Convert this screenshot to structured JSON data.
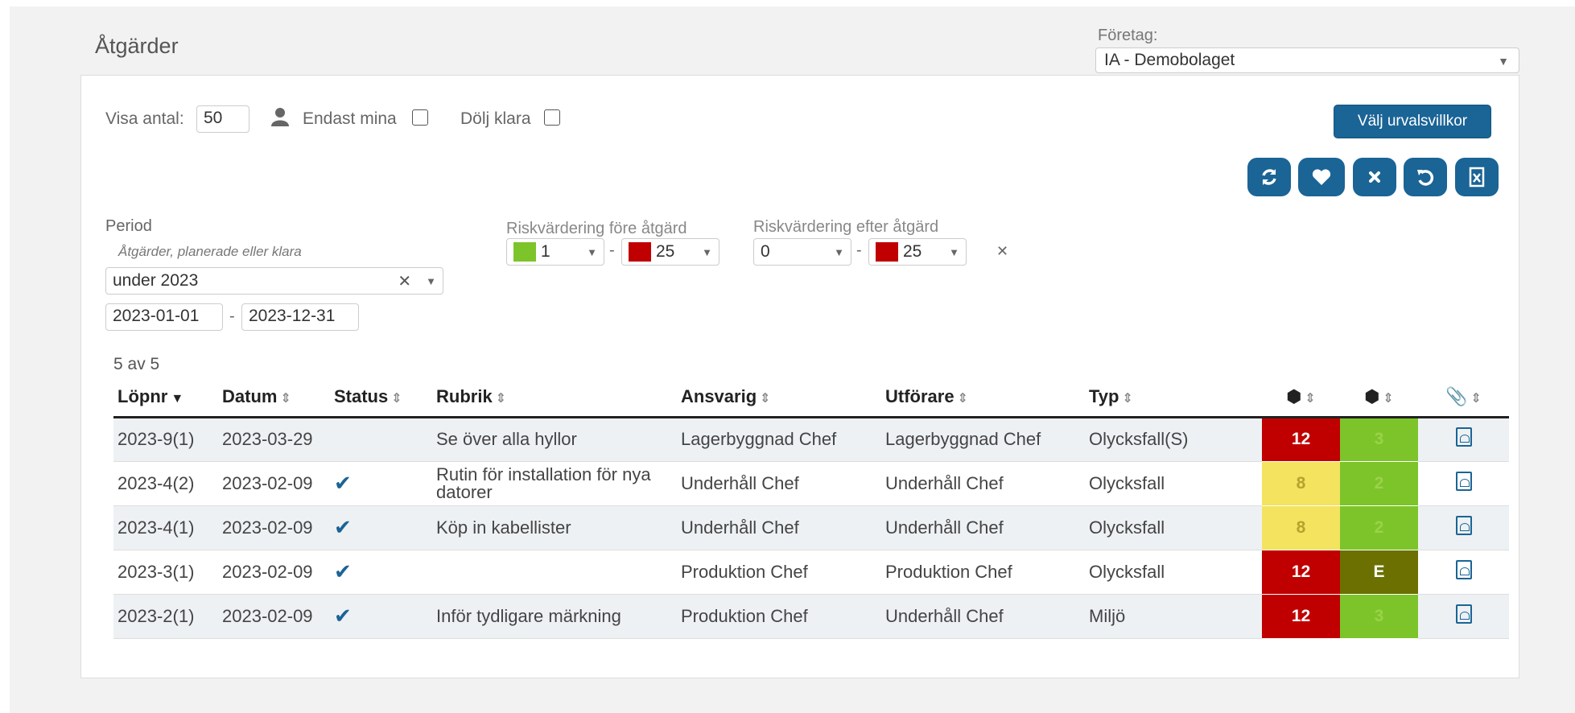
{
  "page": {
    "title": "Åtgärder"
  },
  "company": {
    "label": "Företag:",
    "value": "IA - Demobolaget"
  },
  "filters": {
    "show_count_label": "Visa antal:",
    "show_count_value": "50",
    "only_mine_label": "Endast mina",
    "hide_done_label": "Dölj klara",
    "choose_criteria_label": "Välj urvalsvillkor",
    "period_label": "Period",
    "period_hint": "Åtgärder, planerade eller klara",
    "period_value": "under 2023",
    "date_from": "2023-01-01",
    "date_to": "2023-12-31",
    "risk_before_label": "Riskvärdering före åtgärd",
    "risk_before_from": "1",
    "risk_before_to": "25",
    "risk_after_label": "Riskvärdering efter åtgärd",
    "risk_after_from": "0",
    "risk_after_to": "25",
    "dash": "-"
  },
  "colors": {
    "primary": "#1a6496",
    "risk_red": "#c00000",
    "risk_yellow": "#f3e35f",
    "risk_green": "#7cc42a",
    "risk_olive": "#6b7000"
  },
  "table": {
    "count_text": "5 av 5",
    "columns": [
      "Löpnr",
      "Datum",
      "Status",
      "Rubrik",
      "Ansvarig",
      "Utförare",
      "Typ"
    ],
    "rows": [
      {
        "lopnr": "2023-9(1)",
        "datum": "2023-03-29",
        "done": false,
        "rubrik": "Se över alla hyllor",
        "ansvarig": "Lagerbyggnad Chef",
        "utforare": "Lagerbyggnad Chef",
        "typ": "Olycksfall(S)",
        "risk_before": "12",
        "risk_before_color": "#c00000",
        "risk_after": "3",
        "risk_after_color": "#7cc42a"
      },
      {
        "lopnr": "2023-4(2)",
        "datum": "2023-02-09",
        "done": true,
        "rubrik": "Rutin för installation för nya datorer",
        "ansvarig": "Underhåll Chef",
        "utforare": "Underhåll Chef",
        "typ": "Olycksfall",
        "risk_before": "8",
        "risk_before_color": "#f3e35f",
        "risk_after": "2",
        "risk_after_color": "#7cc42a"
      },
      {
        "lopnr": "2023-4(1)",
        "datum": "2023-02-09",
        "done": true,
        "rubrik": "Köp in kabellister",
        "ansvarig": "Underhåll Chef",
        "utforare": "Underhåll Chef",
        "typ": "Olycksfall",
        "risk_before": "8",
        "risk_before_color": "#f3e35f",
        "risk_after": "2",
        "risk_after_color": "#7cc42a"
      },
      {
        "lopnr": "2023-3(1)",
        "datum": "2023-02-09",
        "done": true,
        "rubrik": "",
        "ansvarig": "Produktion Chef",
        "utforare": "Produktion Chef",
        "typ": "Olycksfall",
        "risk_before": "12",
        "risk_before_color": "#c00000",
        "risk_after": "E",
        "risk_after_color": "#6b7000"
      },
      {
        "lopnr": "2023-2(1)",
        "datum": "2023-02-09",
        "done": true,
        "rubrik": "Inför tydligare märkning",
        "ansvarig": "Produktion Chef",
        "utforare": "Underhåll Chef",
        "typ": "Miljö",
        "risk_before": "12",
        "risk_before_color": "#c00000",
        "risk_after": "3",
        "risk_after_color": "#7cc42a"
      }
    ]
  }
}
